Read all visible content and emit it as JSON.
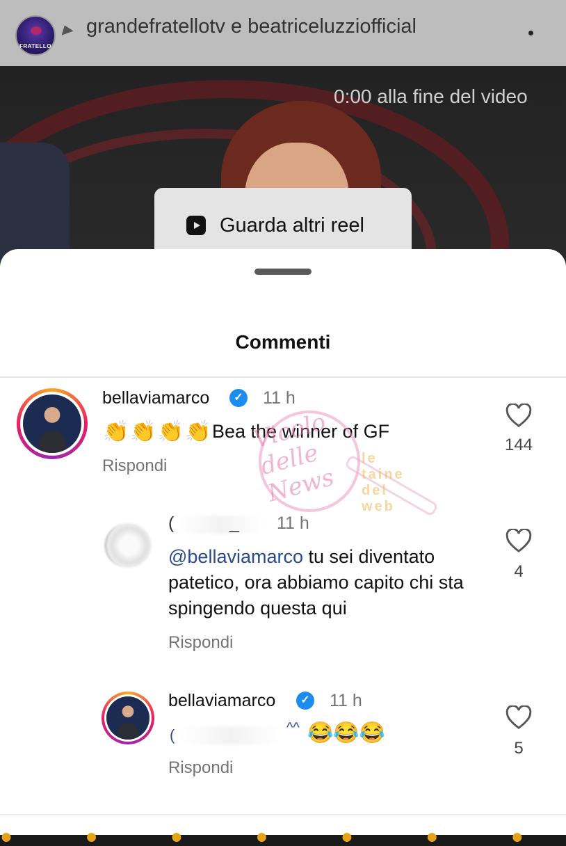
{
  "header": {
    "owner_names": "grandefratellotv e beatriceluzziofficial",
    "avatar_logo_text": "FRATELLO",
    "more_icon": "more-dots-icon"
  },
  "video": {
    "timer_text": "0:00 alla fine del video",
    "reel_button_label": "Guarda altri reel",
    "reel_icon": "reels-icon"
  },
  "sheet": {
    "title": "Commenti"
  },
  "comments": [
    {
      "username": "bellaviamarco",
      "verified": true,
      "time": "11 h",
      "text": "Bea the winner of GF",
      "claps": "👏👏👏👏",
      "reply_label": "Rispondi",
      "likes": "144"
    },
    {
      "username_partial": "(",
      "username_tail": "_",
      "time": "11 h",
      "mention": "@bellaviamarco",
      "text": " tu sei diventato patetico, ora abbiamo capito chi sta spingendo questa qui",
      "reply_label": "Rispondi",
      "likes": "4"
    },
    {
      "username": "bellaviamarco",
      "verified": true,
      "time": "11 h",
      "text_partial": "(",
      "text_partial_tail": "^^",
      "emojis": "😂😂😂",
      "reply_label": "Rispondi",
      "likes": "5"
    }
  ],
  "watermark": {
    "text1": "Vicolo delle News",
    "text2": "le taine del web"
  },
  "colors": {
    "verified": "#1d8cf0",
    "mention": "#2a4a8f",
    "secondary_text": "#737373"
  }
}
